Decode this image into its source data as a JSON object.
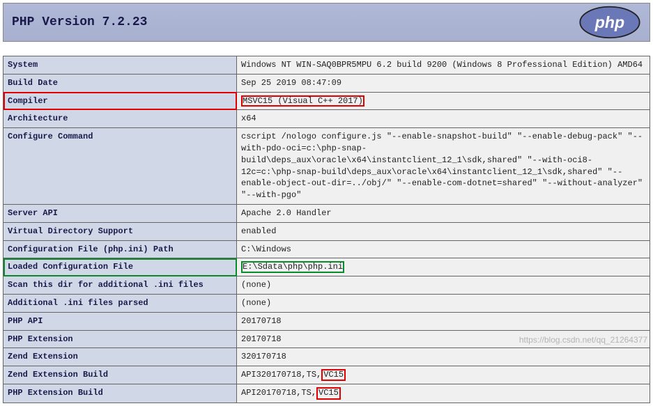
{
  "header": {
    "title": "PHP Version 7.2.23",
    "logo_text": "php"
  },
  "rows": {
    "system": {
      "key": "System",
      "val": "Windows NT WIN-SAQ0BPR5MPU 6.2 build 9200 (Windows 8 Professional Edition) AMD64"
    },
    "build_date": {
      "key": "Build Date",
      "val": "Sep 25 2019 08:47:09"
    },
    "compiler": {
      "key": "Compiler",
      "val": "MSVC15 (Visual C++ 2017)"
    },
    "architecture": {
      "key": "Architecture",
      "val": "x64"
    },
    "configure_command": {
      "key": "Configure Command",
      "val": "cscript /nologo configure.js \"--enable-snapshot-build\" \"--enable-debug-pack\" \"--with-pdo-oci=c:\\php-snap-build\\deps_aux\\oracle\\x64\\instantclient_12_1\\sdk,shared\" \"--with-oci8-12c=c:\\php-snap-build\\deps_aux\\oracle\\x64\\instantclient_12_1\\sdk,shared\" \"--enable-object-out-dir=../obj/\" \"--enable-com-dotnet=shared\" \"--without-analyzer\" \"--with-pgo\""
    },
    "server_api": {
      "key": "Server API",
      "val": "Apache 2.0 Handler"
    },
    "virtual_dir": {
      "key": "Virtual Directory Support",
      "val": "enabled"
    },
    "config_path": {
      "key": "Configuration File (php.ini) Path",
      "val": "C:\\Windows"
    },
    "loaded_config": {
      "key": "Loaded Configuration File",
      "val": "E:\\Sdata\\php\\php.ini"
    },
    "scan_dir": {
      "key": "Scan this dir for additional .ini files",
      "val": "(none)"
    },
    "additional_ini": {
      "key": "Additional .ini files parsed",
      "val": "(none)"
    },
    "php_api": {
      "key": "PHP API",
      "val": "20170718"
    },
    "php_ext": {
      "key": "PHP Extension",
      "val": "20170718"
    },
    "zend_ext": {
      "key": "Zend Extension",
      "val": "320170718"
    },
    "zend_ext_build": {
      "key": "Zend Extension Build",
      "prefix": "API320170718,TS,",
      "vc": "VC15"
    },
    "php_ext_build": {
      "key": "PHP Extension Build",
      "prefix": "API20170718,TS,",
      "vc": "VC15"
    }
  },
  "watermark": "https://blog.csdn.net/qq_21264377"
}
